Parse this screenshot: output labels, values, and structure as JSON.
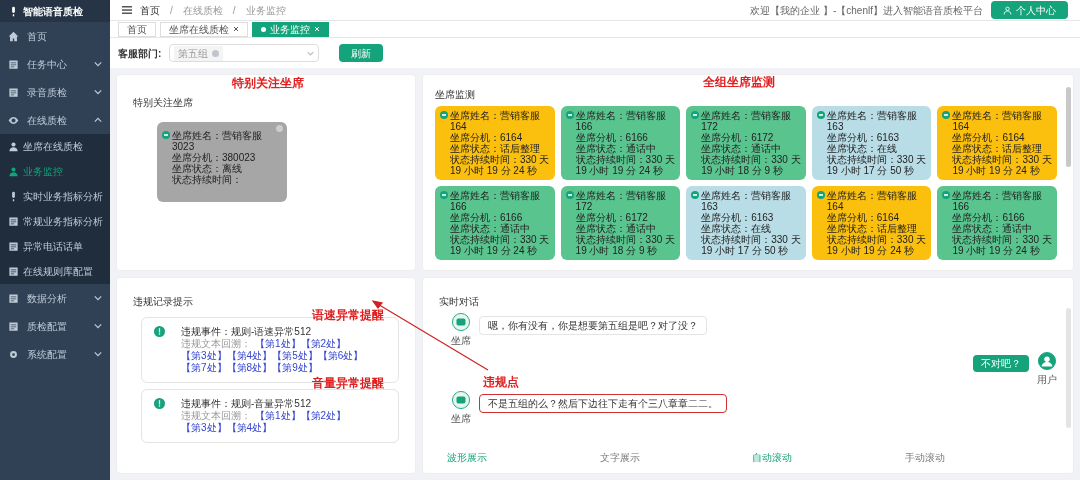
{
  "sidebar": {
    "title": "智能语音质检",
    "items": [
      {
        "label": "首页",
        "selected": false
      },
      {
        "label": "任务中心",
        "expandable": true,
        "expanded": false,
        "selected": false
      },
      {
        "label": "录音质检",
        "expandable": true,
        "expanded": false,
        "selected": false
      },
      {
        "label": "在线质检",
        "expandable": true,
        "expanded": true,
        "selected": false,
        "children": [
          {
            "label": "坐席在线质检",
            "selected": false
          },
          {
            "label": "业务监控",
            "selected": true
          },
          {
            "label": "实时业务指标分析",
            "selected": false
          },
          {
            "label": "常规业务指标分析",
            "selected": false
          },
          {
            "label": "异常电话话单",
            "selected": false
          },
          {
            "label": "在线规则库配置",
            "selected": false
          }
        ]
      },
      {
        "label": "数据分析",
        "expandable": true,
        "expanded": false,
        "selected": false
      },
      {
        "label": "质检配置",
        "expandable": true,
        "expanded": false,
        "selected": false
      },
      {
        "label": "系统配置",
        "expandable": true,
        "expanded": false,
        "selected": false
      }
    ]
  },
  "breadcrumb": [
    {
      "kind": "link",
      "text": "首页"
    },
    {
      "kind": "separator",
      "text": "/"
    },
    {
      "kind": "link",
      "text": "在线质检"
    },
    {
      "kind": "separator",
      "text": "/"
    },
    {
      "kind": "link",
      "text": "业务监控"
    }
  ],
  "welcome": "欢迎【我的企业 】-【chenlf】进入智能语音质检平台",
  "profile_button": "个人中心",
  "tabs": [
    {
      "label": "首页",
      "closable": false,
      "selected": false
    },
    {
      "label": "坐席在线质检",
      "closable": true,
      "selected": false
    },
    {
      "label": "业务监控",
      "closable": true,
      "selected": true
    }
  ],
  "filter": {
    "label": "客服部门:",
    "tag": "第五组",
    "button": "刷新"
  },
  "focus_panel": {
    "title": "特别关注坐席",
    "annotation": "特别关注坐席",
    "cards": [
      {
        "lines": [
          "坐席姓名：营销客服3023",
          "坐席分机：380023",
          "坐席状态：离线",
          "状态持续时间："
        ],
        "color": "#a6a6a6"
      }
    ]
  },
  "monitor_panel": {
    "title": "坐席监测",
    "annotation": "全组坐席监测",
    "cards": [
      {
        "lines": [
          "坐席姓名：营销客服164",
          "坐席分机：6164",
          "坐席状态：话后整理",
          "状态持续时间：330 天 19 小时 19 分 24 秒"
        ],
        "color": "#fbbf0e"
      },
      {
        "lines": [
          "坐席姓名：营销客服166",
          "坐席分机：6166",
          "坐席状态：通话中",
          "状态持续时间：330 天 19 小时 19 分 24 秒"
        ],
        "color": "#5ac48f"
      },
      {
        "lines": [
          "坐席姓名：营销客服172",
          "坐席分机：6172",
          "坐席状态：通话中",
          "状态持续时间：330 天 19 小时 18 分 9 秒"
        ],
        "color": "#5ac48f"
      },
      {
        "lines": [
          "坐席姓名：营销客服163",
          "坐席分机：6163",
          "坐席状态：在线",
          "状态持续时间：330 天 19 小时 17 分 50 秒"
        ],
        "color": "#b8dde6"
      },
      {
        "lines": [
          "坐席姓名：营销客服164",
          "坐席分机：6164",
          "坐席状态：话后整理",
          "状态持续时间：330 天 19 小时 19 分 24 秒"
        ],
        "color": "#fbbf0e"
      },
      {
        "lines": [
          "坐席姓名：营销客服166",
          "坐席分机：6166",
          "坐席状态：通话中",
          "状态持续时间：330 天 19 小时 19 分 24 秒"
        ],
        "color": "#5ac48f"
      },
      {
        "lines": [
          "坐席姓名：营销客服172",
          "坐席分机：6172",
          "坐席状态：通话中",
          "状态持续时间：330 天 19 小时 18 分 9 秒"
        ],
        "color": "#5ac48f"
      },
      {
        "lines": [
          "坐席姓名：营销客服163",
          "坐席分机：6163",
          "坐席状态：在线",
          "状态持续时间：330 天 19 小时 17 分 50 秒"
        ],
        "color": "#b8dde6"
      },
      {
        "lines": [
          "坐席姓名：营销客服164",
          "坐席分机：6164",
          "坐席状态：话后整理",
          "状态持续时间：330 天 19 小时 19 分 24 秒"
        ],
        "color": "#fbbf0e"
      },
      {
        "lines": [
          "坐席姓名：营销客服166",
          "坐席分机：6166",
          "坐席状态：通话中",
          "状态持续时间：330 天 19 小时 19 分 24 秒"
        ],
        "color": "#5ac48f"
      }
    ]
  },
  "violation_panel": {
    "title": "违规记录提示",
    "records": [
      {
        "event": "违规事件：规则-语速异常512",
        "label": "违规文本回溯：",
        "links": [
          "【第1处】",
          "【第2处】",
          "【第3处】",
          "【第4处】",
          "【第5处】",
          "【第6处】",
          "【第7处】",
          "【第8处】",
          "【第9处】"
        ],
        "annotation": "语速异常提醒"
      },
      {
        "event": "违规事件：规则-音量异常512",
        "label": "违规文本回溯：",
        "links": [
          "【第1处】",
          "【第2处】",
          "【第3处】",
          "【第4处】"
        ],
        "annotation": "音量异常提醒"
      }
    ]
  },
  "chat_panel": {
    "title": "实时对话",
    "messages": [
      {
        "kind": "agent",
        "name": "坐席",
        "text": "嗯，你有没有，你是想要第五组是吧？对了没？",
        "violation": false
      },
      {
        "kind": "user",
        "name": "用户",
        "text": "不对吧？"
      },
      {
        "kind": "agent",
        "name": "坐席",
        "text": "不是五组的么？然后下边往下走有个三八章章二二。",
        "violation": true
      }
    ],
    "violation_annotation": "违规点",
    "options": [
      {
        "label": "波形展示",
        "selected": true
      },
      {
        "label": "文字展示",
        "selected": false
      },
      {
        "label": "自动滚动",
        "selected": true
      },
      {
        "label": "手动滚动",
        "selected": false
      }
    ]
  }
}
